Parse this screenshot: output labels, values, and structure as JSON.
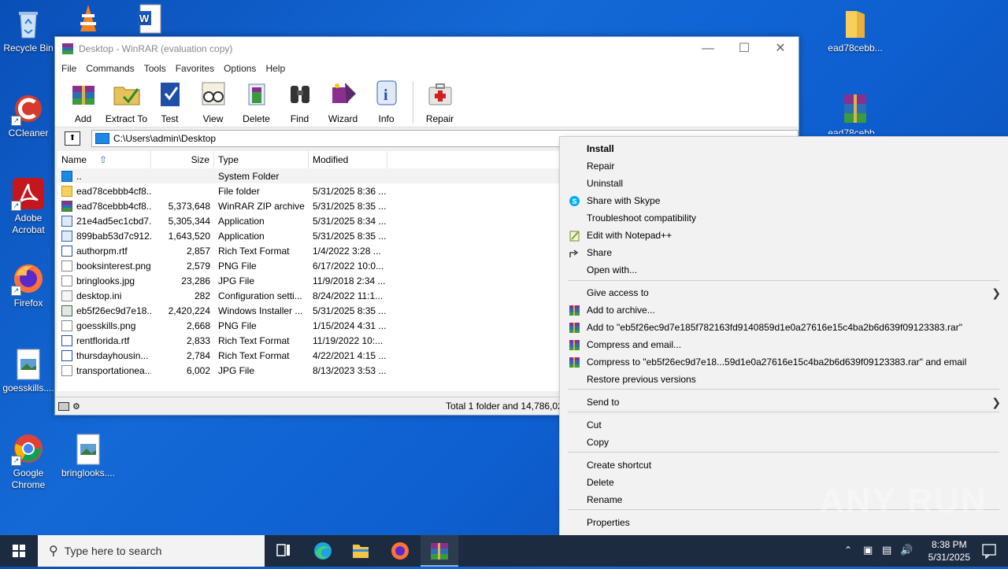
{
  "desktop": {
    "icons": [
      {
        "label": "Recycle Bin"
      },
      {
        "label": "CCleaner"
      },
      {
        "label": "Adobe Acrobat"
      },
      {
        "label": "Firefox"
      },
      {
        "label": "goesskills...."
      },
      {
        "label": "Google Chrome"
      },
      {
        "label": "bringlooks...."
      },
      {
        "label": "ead78cebb..."
      },
      {
        "label": "ead78cebb..."
      }
    ]
  },
  "winrar": {
    "title": "Desktop - WinRAR (evaluation copy)",
    "menu": [
      "File",
      "Commands",
      "Tools",
      "Favorites",
      "Options",
      "Help"
    ],
    "toolbar": [
      "Add",
      "Extract To",
      "Test",
      "View",
      "Delete",
      "Find",
      "Wizard",
      "Info",
      "Repair"
    ],
    "address": "C:\\Users\\admin\\Desktop",
    "columns": {
      "name": "Name",
      "size": "Size",
      "type": "Type",
      "modified": "Modified"
    },
    "files": [
      {
        "name": "..",
        "size": "",
        "type": "System Folder",
        "modified": "",
        "icon": "folder-up"
      },
      {
        "name": "ead78cebbb4cf8...",
        "size": "",
        "type": "File folder",
        "modified": "5/31/2025 8:36 ...",
        "icon": "folder"
      },
      {
        "name": "ead78cebbb4cf8...",
        "size": "5,373,648",
        "type": "WinRAR ZIP archive",
        "modified": "5/31/2025 8:35 ...",
        "icon": "archive"
      },
      {
        "name": "21e4ad5ec1cbd7...",
        "size": "5,305,344",
        "type": "Application",
        "modified": "5/31/2025 8:34 ...",
        "icon": "app"
      },
      {
        "name": "899bab53d7c912...",
        "size": "1,643,520",
        "type": "Application",
        "modified": "5/31/2025 8:35 ...",
        "icon": "app"
      },
      {
        "name": "authorpm.rtf",
        "size": "2,857",
        "type": "Rich Text Format",
        "modified": "1/4/2022 3:28 ...",
        "icon": "doc"
      },
      {
        "name": "booksinterest.png",
        "size": "2,579",
        "type": "PNG File",
        "modified": "6/17/2022 10:0...",
        "icon": "image"
      },
      {
        "name": "bringlooks.jpg",
        "size": "23,286",
        "type": "JPG File",
        "modified": "11/9/2018 2:34 ...",
        "icon": "image"
      },
      {
        "name": "desktop.ini",
        "size": "282",
        "type": "Configuration setti...",
        "modified": "8/24/2022 11:1...",
        "icon": "ini"
      },
      {
        "name": "eb5f26ec9d7e18...",
        "size": "2,420,224",
        "type": "Windows Installer ...",
        "modified": "5/31/2025 8:35 ...",
        "icon": "msi"
      },
      {
        "name": "goesskills.png",
        "size": "2,668",
        "type": "PNG File",
        "modified": "1/15/2024 4:31 ...",
        "icon": "image"
      },
      {
        "name": "rentflorida.rtf",
        "size": "2,833",
        "type": "Rich Text Format",
        "modified": "11/19/2022 10:...",
        "icon": "doc"
      },
      {
        "name": "thursdayhousin...",
        "size": "2,784",
        "type": "Rich Text Format",
        "modified": "4/22/2021 4:15 ...",
        "icon": "doc"
      },
      {
        "name": "transportationea...",
        "size": "6,002",
        "type": "JPG File",
        "modified": "8/13/2023 3:53 ...",
        "icon": "image"
      }
    ],
    "status": "Total 1 folder and 14,786,02"
  },
  "context_menu": {
    "items": [
      {
        "label": "Install",
        "bold": true
      },
      {
        "label": "Repair"
      },
      {
        "label": "Uninstall"
      },
      {
        "label": "Share with Skype",
        "icon": "skype-icon"
      },
      {
        "label": "Troubleshoot compatibility"
      },
      {
        "label": "Edit with Notepad++",
        "icon": "notepadpp-icon"
      },
      {
        "label": "Share",
        "icon": "share-icon"
      },
      {
        "label": "Open with..."
      },
      {
        "label": "Give access to",
        "submenu": true
      },
      {
        "label": "Add to archive...",
        "icon": "winrar-icon"
      },
      {
        "label": "Add to \"eb5f26ec9d7e185f782163fd9140859d1e0a27616e15c4ba2b6d639f09123383.rar\"",
        "icon": "winrar-icon"
      },
      {
        "label": "Compress and email...",
        "icon": "winrar-icon"
      },
      {
        "label": "Compress to \"eb5f26ec9d7e18...59d1e0a27616e15c4ba2b6d639f09123383.rar\" and email",
        "icon": "winrar-icon"
      },
      {
        "label": "Restore previous versions"
      },
      {
        "label": "Send to",
        "submenu": true
      },
      {
        "label": "Cut"
      },
      {
        "label": "Copy"
      },
      {
        "label": "Create shortcut"
      },
      {
        "label": "Delete"
      },
      {
        "label": "Rename"
      },
      {
        "label": "Properties"
      }
    ]
  },
  "taskbar": {
    "search_placeholder": "Type here to search",
    "time": "8:38 PM",
    "date": "5/31/2025"
  },
  "watermark": "ANY RUN"
}
